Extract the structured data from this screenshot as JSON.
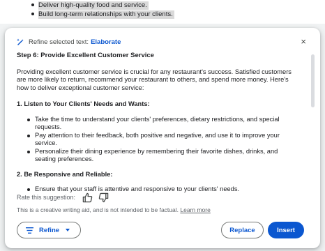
{
  "background_doc": {
    "items": [
      "Deliver high-quality food and service.",
      "Build long-term relationships with your clients."
    ]
  },
  "dialog": {
    "title_prefix": "Refine selected text:",
    "mode": "Elaborate",
    "close_label": "×",
    "content": {
      "heading": "Step 6: Provide Excellent Customer Service",
      "intro": "Providing excellent customer service is crucial for any restaurant's success. Satisfied customers are more likely to return, recommend your restaurant to others, and spend more money. Here's how to deliver exceptional customer service:",
      "sections": [
        {
          "title": "1. Listen to Your Clients' Needs and Wants:",
          "bullets": [
            "Take the time to understand your clients' preferences, dietary restrictions, and special requests.",
            "Pay attention to their feedback, both positive and negative, and use it to improve your service.",
            "Personalize their dining experience by remembering their favorite dishes, drinks, and seating preferences."
          ]
        },
        {
          "title": "2. Be Responsive and Reliable:",
          "bullets": [
            "Ensure that your staff is attentive and responsive to your clients' needs."
          ]
        }
      ]
    },
    "rate_label": "Rate this suggestion:",
    "disclaimer": "This is a creative writing aid, and is not intended to be factual.",
    "learn_more": "Learn more",
    "refine_label": "Refine",
    "replace_label": "Replace",
    "insert_label": "Insert",
    "accent_color": "#0b57d0",
    "icons": [
      "pen-sparkle-icon",
      "close-icon",
      "thumbs-up-icon",
      "thumbs-down-icon",
      "menu-lines-icon",
      "caret-down-icon"
    ]
  }
}
